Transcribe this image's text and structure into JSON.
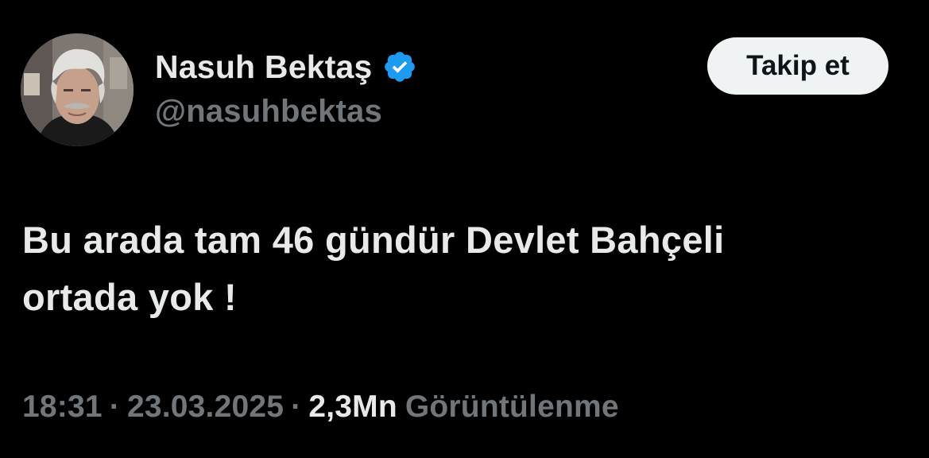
{
  "author": {
    "display_name": "Nasuh Bektaş",
    "handle": "@nasuhbektas",
    "verified": true,
    "avatar": "profile-photo"
  },
  "follow_button": {
    "label": "Takip et"
  },
  "tweet": {
    "text_line_1": "Bu arada tam 46 gündür Devlet Bahçeli",
    "text_line_2": "ortada yok !"
  },
  "meta": {
    "time": "18:31",
    "separator": "·",
    "date": "23.03.2025",
    "views_count": "2,3Mn",
    "views_label": "Görüntülenme"
  },
  "colors": {
    "background": "#000000",
    "primary_text": "#e7e9ea",
    "secondary_text": "#71767b",
    "verified_badge": "#1d9bf0",
    "button_background": "#eff3f4",
    "button_text": "#0f1419"
  },
  "icons": {
    "verified": "verified-badge-icon"
  }
}
